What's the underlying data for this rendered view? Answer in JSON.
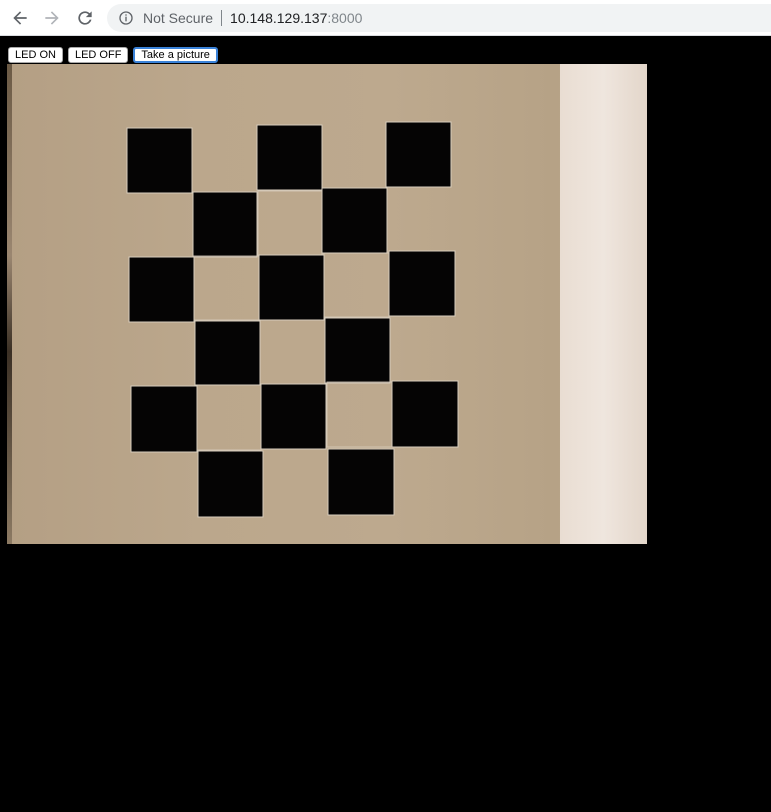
{
  "browser": {
    "security_text": "Not Secure",
    "url_host": "10.148.129.137",
    "url_port": ":8000",
    "icons": {
      "back": "arrow-left-icon",
      "forward": "arrow-right-icon",
      "reload": "reload-icon",
      "info": "info-icon"
    }
  },
  "controls": {
    "led_on_label": "LED ON",
    "led_off_label": "LED OFF",
    "take_picture_label": "Take a picture"
  },
  "camera": {
    "content": "checkerboard-calibration-pattern",
    "colors": {
      "board": "#bca88c",
      "squares": "#050404",
      "light_squares": "#b8a488",
      "background": "#000000"
    }
  }
}
